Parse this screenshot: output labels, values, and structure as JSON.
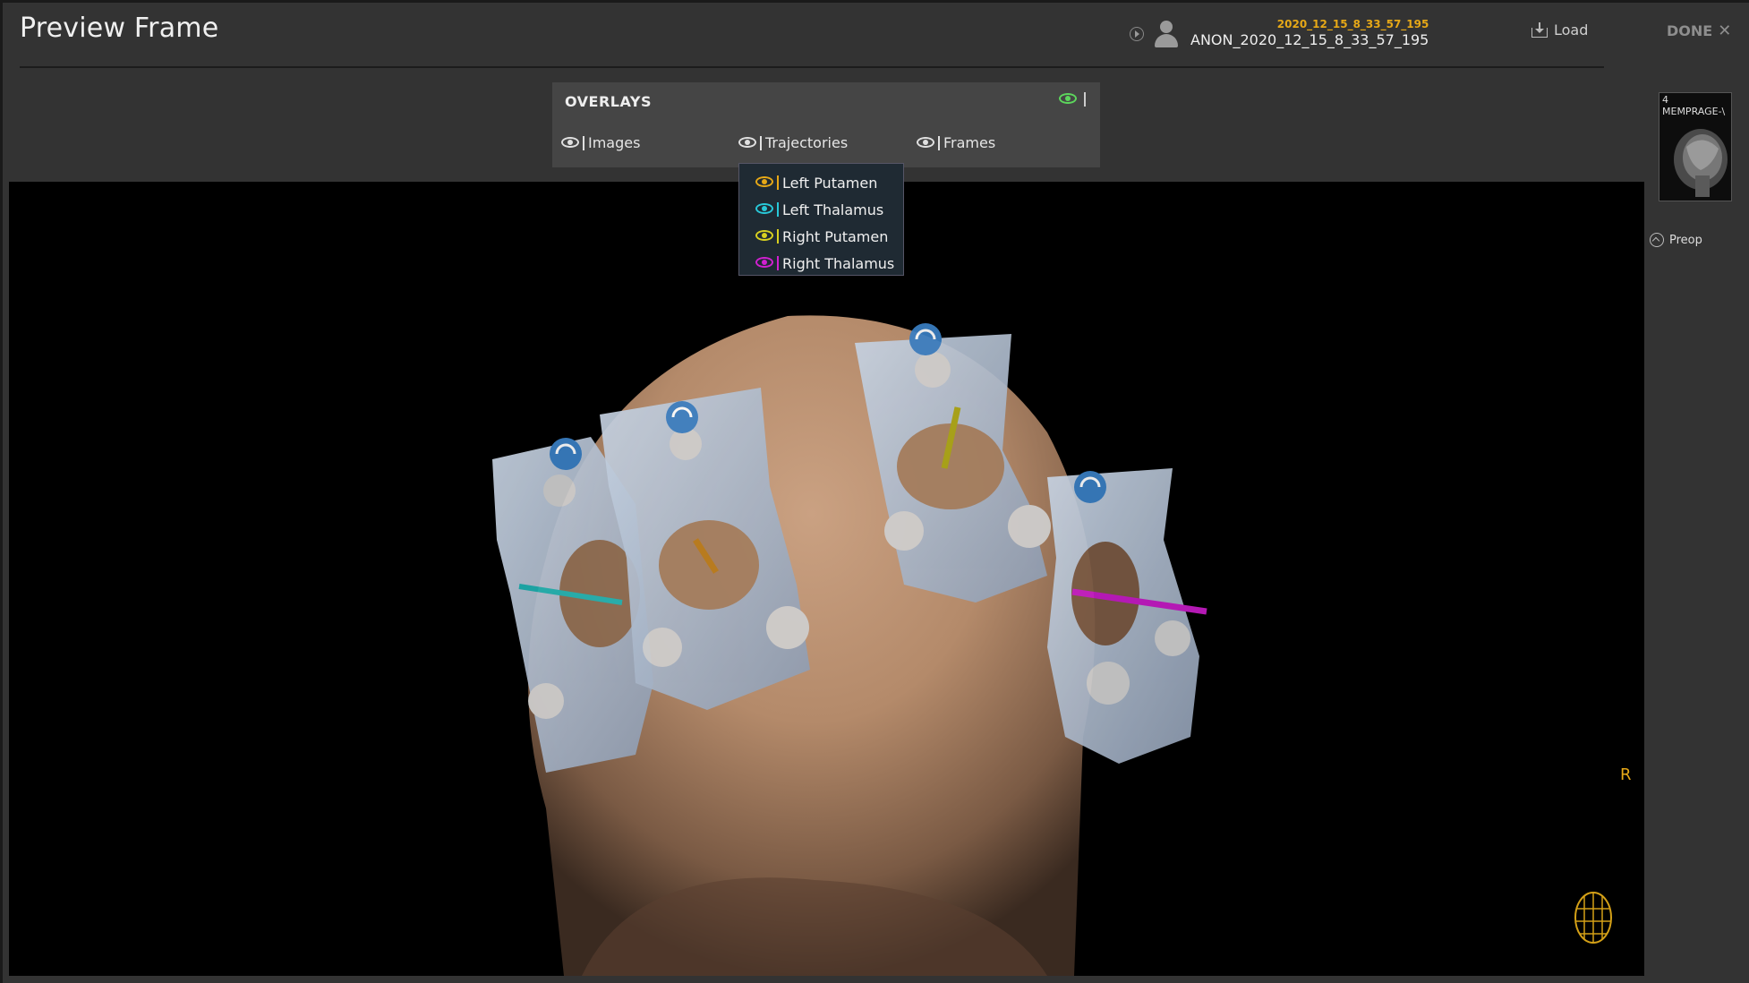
{
  "header": {
    "title": "Preview Frame",
    "patient_date": "2020_12_15_8_33_57_195",
    "patient_id": "ANON_2020_12_15_8_33_57_195",
    "load_label": "Load",
    "done_label": "DONE"
  },
  "overlays": {
    "title": "OVERLAYS",
    "items": [
      {
        "label": "Images"
      },
      {
        "label": "Trajectories"
      },
      {
        "label": "Frames"
      }
    ],
    "master_eye_color": "#5cd65c"
  },
  "trajectories_menu": [
    {
      "label": "Left Putamen",
      "color": "#e6a817"
    },
    {
      "label": "Left Thalamus",
      "color": "#28c8d8"
    },
    {
      "label": "Right Putamen",
      "color": "#d8d020"
    },
    {
      "label": "Right Thalamus",
      "color": "#d020d0"
    }
  ],
  "viewport": {
    "orientation_label": "R"
  },
  "sidebar": {
    "series_number": "4",
    "series_label": "MEMPRAGE-\\",
    "preop_label": "Preop"
  },
  "colors": {
    "accent_orange": "#e6a817",
    "background": "#333333",
    "viewport_bg": "#000000",
    "frame_blue": "#aab8cc",
    "rotate_button": "#3a7fc4"
  },
  "icons": [
    "info-icon",
    "avatar-icon",
    "load-icon",
    "close-icon",
    "eye-icon",
    "rotate-icon",
    "head-orientation-icon",
    "chevron-up-icon"
  ]
}
